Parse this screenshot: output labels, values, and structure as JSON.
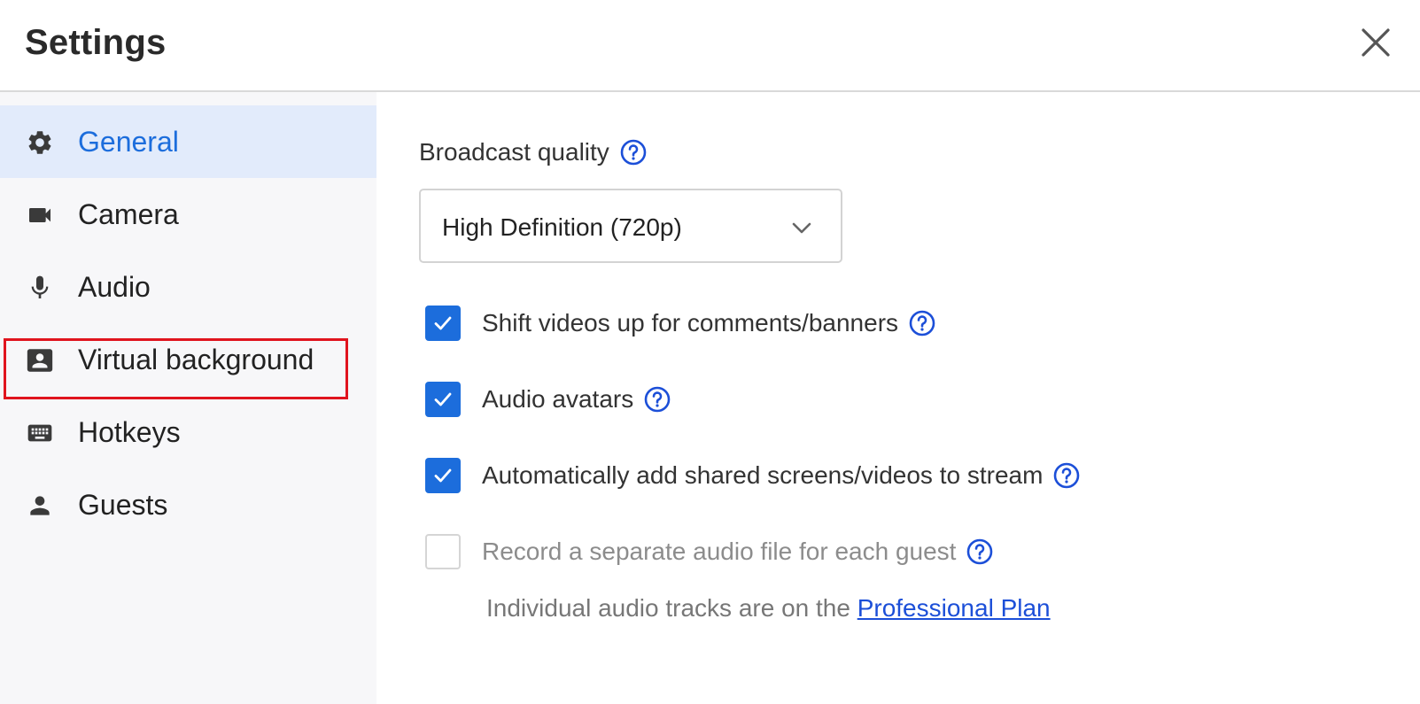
{
  "header": {
    "title": "Settings",
    "close_icon": "close-icon"
  },
  "sidebar": {
    "items": [
      {
        "label": "General",
        "icon": "gear-icon",
        "active": true
      },
      {
        "label": "Camera",
        "icon": "video-camera-icon",
        "active": false
      },
      {
        "label": "Audio",
        "icon": "microphone-icon",
        "active": false
      },
      {
        "label": "Virtual background",
        "icon": "portrait-card-icon",
        "active": false,
        "highlighted": true
      },
      {
        "label": "Hotkeys",
        "icon": "keyboard-icon",
        "active": false
      },
      {
        "label": "Guests",
        "icon": "person-icon",
        "active": false
      }
    ]
  },
  "main": {
    "broadcast_quality": {
      "label": "Broadcast quality",
      "selected": "High Definition (720p)"
    },
    "options": [
      {
        "label": "Shift videos up for comments/banners",
        "checked": true,
        "disabled": false
      },
      {
        "label": "Audio avatars",
        "checked": true,
        "disabled": false
      },
      {
        "label": "Automatically add shared screens/videos to stream",
        "checked": true,
        "disabled": false
      },
      {
        "label": "Record a separate audio file for each guest",
        "checked": false,
        "disabled": true
      }
    ],
    "note": {
      "text": "Individual audio tracks are on the ",
      "link_text": "Professional Plan"
    }
  },
  "colors": {
    "accent": "#1c6ddc",
    "active_bg": "#e2ebfb",
    "sidebar_bg": "#f7f7f9",
    "highlight": "#e0141e",
    "help_icon": "#1c4fd8"
  }
}
